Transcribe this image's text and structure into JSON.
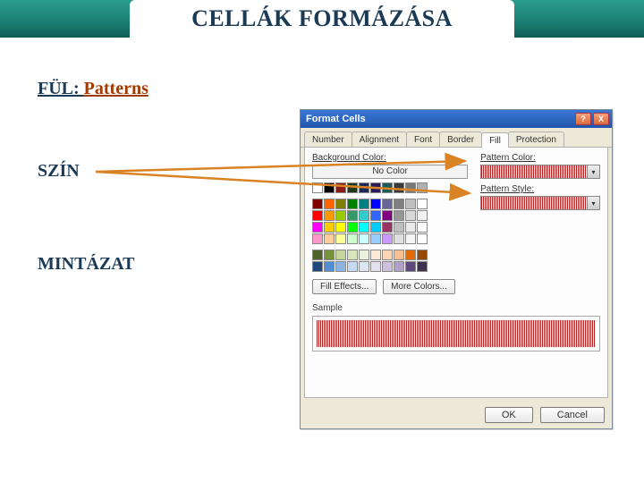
{
  "page": {
    "title": "CELLÁK FORMÁZÁSA"
  },
  "labels": {
    "tab_prefix": "FÜL: ",
    "tab_name": "Patterns",
    "color": "SZÍN",
    "pattern": "MINTÁZAT"
  },
  "dialog": {
    "title": "Format Cells",
    "help_btn": "?",
    "close_btn": "X",
    "tabs": [
      "Number",
      "Alignment",
      "Font",
      "Border",
      "Fill",
      "Protection"
    ],
    "active_tab": 4,
    "bg_label": "Background Color:",
    "no_color": "No Color",
    "fill_effects": "Fill Effects...",
    "more_colors": "More Colors...",
    "pattern_color": "Pattern Color:",
    "pattern_style": "Pattern Style:",
    "sample": "Sample",
    "ok": "OK",
    "cancel": "Cancel",
    "swatches_row1": [
      "#ffffff",
      "#000000",
      "#8b1a1a",
      "#1f3a1f",
      "#1a2a5a",
      "#2a1a5a",
      "#1a5a5a",
      "#3a3a3a",
      "#7a7a7a",
      "#b0b0b0"
    ],
    "swatches_main": [
      "#800000",
      "#ff6600",
      "#808000",
      "#008000",
      "#008080",
      "#0000ff",
      "#666699",
      "#808080",
      "#c0c0c0",
      "#ffffff",
      "#ff0000",
      "#ff9900",
      "#99cc00",
      "#339966",
      "#33cccc",
      "#3366ff",
      "#800080",
      "#969696",
      "#d8d8d8",
      "#f2f2f2",
      "#ff00ff",
      "#ffcc00",
      "#ffff00",
      "#00ff00",
      "#00ffff",
      "#00ccff",
      "#993366",
      "#bfbfbf",
      "#eaeaea",
      "#fafafa",
      "#ff99cc",
      "#ffcc99",
      "#ffff99",
      "#ccffcc",
      "#ccffff",
      "#99ccff",
      "#cc99ff",
      "#e0e0e0",
      "#f5f5f5",
      "#ffffff"
    ],
    "swatches_theme": [
      "#4f6228",
      "#76933c",
      "#c4d79b",
      "#d8e4bc",
      "#ebf1de",
      "#fde9d9",
      "#fcd5b4",
      "#fabf8f",
      "#e26b0a",
      "#974706",
      "#1f497d",
      "#538dd5",
      "#8db4e2",
      "#c5d9f1",
      "#dce6f1",
      "#e4dfec",
      "#ccc0da",
      "#b1a0c7",
      "#60497a",
      "#403151"
    ],
    "pattern_color_value": "#b32020"
  }
}
